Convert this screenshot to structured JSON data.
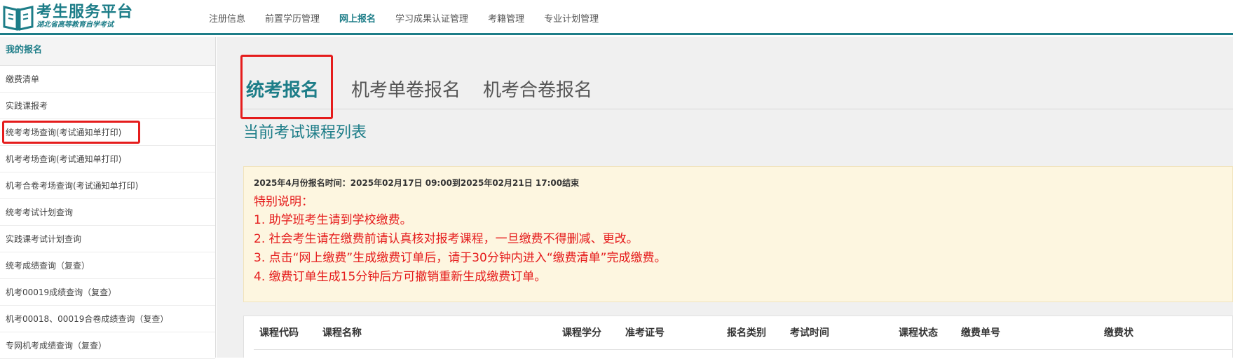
{
  "header": {
    "logo_title": "考生服务平台",
    "logo_subtitle": "湖北省高等教育自学考试",
    "nav": [
      {
        "label": "注册信息"
      },
      {
        "label": "前置学历管理"
      },
      {
        "label": "网上报名",
        "active": true
      },
      {
        "label": "学习成果认证管理"
      },
      {
        "label": "考籍管理"
      },
      {
        "label": "专业计划管理"
      }
    ]
  },
  "sidebar": {
    "title": "我的报名",
    "items": [
      {
        "label": "缴费清单"
      },
      {
        "label": "实践课报考"
      },
      {
        "label": "统考考场查询(考试通知单打印)",
        "highlighted": true
      },
      {
        "label": "机考考场查询(考试通知单打印)"
      },
      {
        "label": "机考合卷考场查询(考试通知单打印)"
      },
      {
        "label": "统考考试计划查询"
      },
      {
        "label": "实践课考试计划查询"
      },
      {
        "label": "统考成绩查询（复查）"
      },
      {
        "label": "机考00019成绩查询（复查）"
      },
      {
        "label": "机考00018、00019合卷成绩查询（复查）"
      },
      {
        "label": "专网机考成绩查询（复查）"
      }
    ]
  },
  "main": {
    "tabs": [
      {
        "label": "统考报名",
        "active": true
      },
      {
        "label": "机考单卷报名"
      },
      {
        "label": "机考合卷报名"
      }
    ],
    "section_title": "当前考试课程列表",
    "notice": {
      "time": "2025年4月份报名时间：2025年02月17日 09:00到2025年02月21日 17:00结束",
      "heading": "特别说明：",
      "lines": [
        "1. 助学班考生请到学校缴费。",
        "2. 社会考生请在缴费前请认真核对报考课程，一旦缴费不得删减、更改。",
        "3. 点击“网上缴费”生成缴费订单后，请于30分钟内进入“缴费清单”完成缴费。",
        "4. 缴费订单生成15分钟后方可撤销重新生成缴费订单。"
      ]
    },
    "table": {
      "columns": [
        "课程代码",
        "课程名称",
        "课程学分",
        "准考证号",
        "报名类别",
        "考试时间",
        "课程状态",
        "缴费单号",
        "缴费状"
      ]
    }
  },
  "colors": {
    "brand": "#1d7d88",
    "alert": "#e51c1c",
    "notice_bg": "#fdf6e0"
  }
}
